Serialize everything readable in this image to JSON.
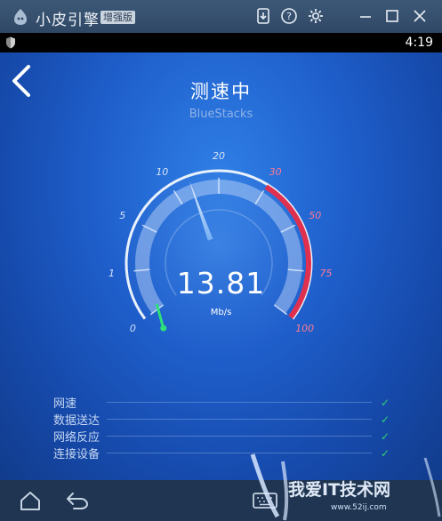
{
  "titlebar": {
    "app_name": "小皮引擎",
    "badge": "增强版",
    "icons": [
      "download-icon",
      "help-icon",
      "settings-icon",
      "minimize-icon",
      "maximize-icon",
      "close-icon"
    ]
  },
  "status_bar": {
    "time": "4:19",
    "icon": "shield-icon"
  },
  "screen": {
    "title": "测速中",
    "subtitle": "BlueStacks",
    "speed_value": "13.81",
    "speed_unit": "Mb/s",
    "gauge": {
      "ticks": [
        {
          "label": "0",
          "value": 0
        },
        {
          "label": "1",
          "value": 1
        },
        {
          "label": "5",
          "value": 5
        },
        {
          "label": "10",
          "value": 10
        },
        {
          "label": "20",
          "value": 20
        },
        {
          "label": "30",
          "value": 30
        },
        {
          "label": "50",
          "value": 50
        },
        {
          "label": "75",
          "value": 75
        },
        {
          "label": "100",
          "value": 100
        }
      ],
      "needle_value": 13.81,
      "red_zone_from": 30,
      "colors": {
        "tick": "#d7e3f5",
        "red_tick": "#ff7b94",
        "red_zone": "#e0304f",
        "progress": "#2ee07a"
      }
    },
    "checklist": [
      {
        "label": "网速",
        "status": "check-icon"
      },
      {
        "label": "数据送达",
        "status": "check-icon"
      },
      {
        "label": "网络反应",
        "status": "check-icon"
      },
      {
        "label": "连接设备",
        "status": "check-icon"
      }
    ]
  },
  "navbar": {
    "icons": [
      "home-icon",
      "back-icon",
      "keyboard-icon"
    ]
  },
  "watermark": {
    "text": "我爱IT技术网",
    "sub": "www.52ij.com"
  }
}
